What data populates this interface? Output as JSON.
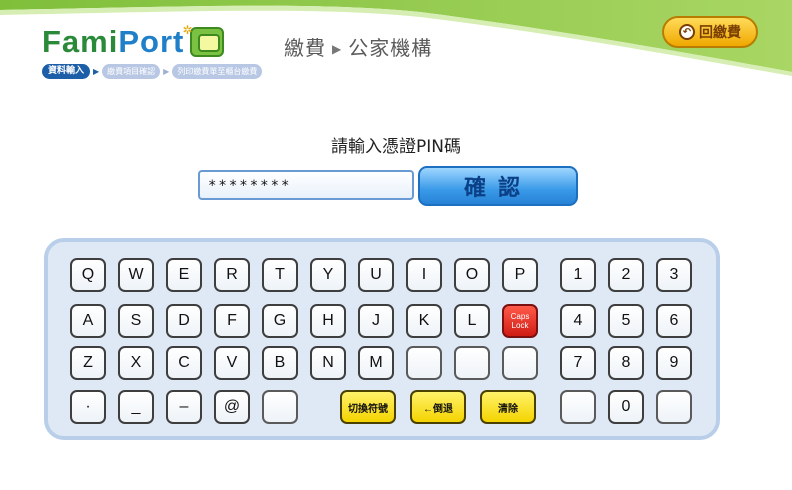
{
  "header": {
    "logo_fami": "Fami",
    "logo_port": "Port",
    "title_left": "繳費",
    "title_arrow": "▶",
    "title_right": "公家機構",
    "back_label": "回繳費",
    "steps": [
      "資料輸入",
      "繳費項目確認",
      "列印繳費單至櫃台繳費"
    ],
    "step_arrow": "▶"
  },
  "form": {
    "prompt": "請輸入憑證PIN碼",
    "pin_value": "********",
    "confirm_label": "確認"
  },
  "keyboard": {
    "row1": [
      "Q",
      "W",
      "E",
      "R",
      "T",
      "Y",
      "U",
      "I",
      "O",
      "P"
    ],
    "row2": [
      "A",
      "S",
      "D",
      "F",
      "G",
      "H",
      "J",
      "K",
      "L"
    ],
    "caps_label": "Caps Lock",
    "row3": [
      "Z",
      "X",
      "C",
      "V",
      "B",
      "N",
      "M"
    ],
    "num_row1": [
      "1",
      "2",
      "3"
    ],
    "num_row2": [
      "4",
      "5",
      "6"
    ],
    "num_row3": [
      "7",
      "8",
      "9"
    ],
    "num_zero": "0",
    "sym_dot": "·",
    "sym_underscore": "_",
    "sym_dash": "–",
    "sym_at": "@",
    "switch_label": "切換符號",
    "backspace_label": "←倒退",
    "clear_label": "清除"
  },
  "colors": {
    "accent_green": "#8dc63f",
    "confirm_blue": "#3a9ae8",
    "back_yellow": "#f0a800",
    "caps_red": "#d01c14",
    "func_yellow": "#f4d400"
  }
}
